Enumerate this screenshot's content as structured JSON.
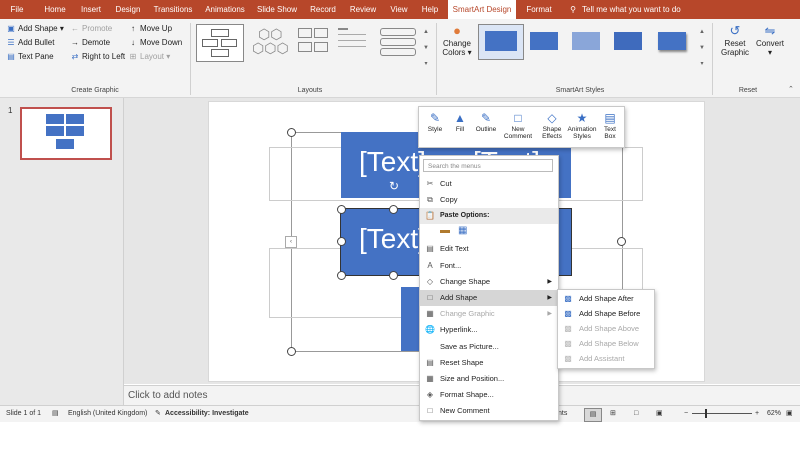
{
  "tabs": [
    "File",
    "Home",
    "Insert",
    "Design",
    "Transitions",
    "Animations",
    "Slide Show",
    "Record",
    "Review",
    "View",
    "Help",
    "SmartArt Design",
    "Format"
  ],
  "tell_me": "Tell me what you want to do",
  "create_graphic": {
    "group_label": "Create Graphic",
    "add_shape": "Add Shape",
    "add_bullet": "Add Bullet",
    "text_pane": "Text Pane",
    "promote": "Promote",
    "demote": "Demote",
    "right_to_left": "Right to Left",
    "move_up": "Move Up",
    "move_down": "Move Down",
    "layout": "Layout"
  },
  "layouts_label": "Layouts",
  "styles": {
    "group_label": "SmartArt Styles",
    "change_colors_1": "Change",
    "change_colors_2": "Colors"
  },
  "reset": {
    "group_label": "Reset",
    "reset_graphic_1": "Reset",
    "reset_graphic_2": "Graphic",
    "convert": "Convert"
  },
  "slide_number": "1",
  "slide_text": "[Text]",
  "notes_placeholder": "Click to add notes",
  "status": {
    "slide": "Slide 1 of 1",
    "language": "English (United Kingdom)",
    "accessibility": "Accessibility: Investigate",
    "comments": "nts",
    "zoom": "62%"
  },
  "minibar": [
    "Style",
    "Fill",
    "Outline",
    "New Comment",
    "Shape Effects",
    "Animation Styles",
    "Text Box"
  ],
  "context_menu": {
    "search_placeholder": "Search the menus",
    "cut": "Cut",
    "copy": "Copy",
    "paste_options": "Paste Options:",
    "edit_text": "Edit Text",
    "font": "Font...",
    "change_shape": "Change Shape",
    "add_shape": "Add Shape",
    "change_graphic": "Change Graphic",
    "hyperlink": "Hyperlink...",
    "save_as_picture": "Save as Picture...",
    "reset_shape": "Reset Shape",
    "size_and_position": "Size and Position...",
    "format_shape": "Format Shape...",
    "new_comment": "New Comment"
  },
  "submenu": {
    "add_after": "Add Shape After",
    "add_before": "Add Shape Before",
    "add_above": "Add Shape Above",
    "add_below": "Add Shape Below",
    "add_assistant": "Add Assistant"
  },
  "colors": {
    "accent": "#b7472a",
    "shape_blue": "#4472c4"
  }
}
